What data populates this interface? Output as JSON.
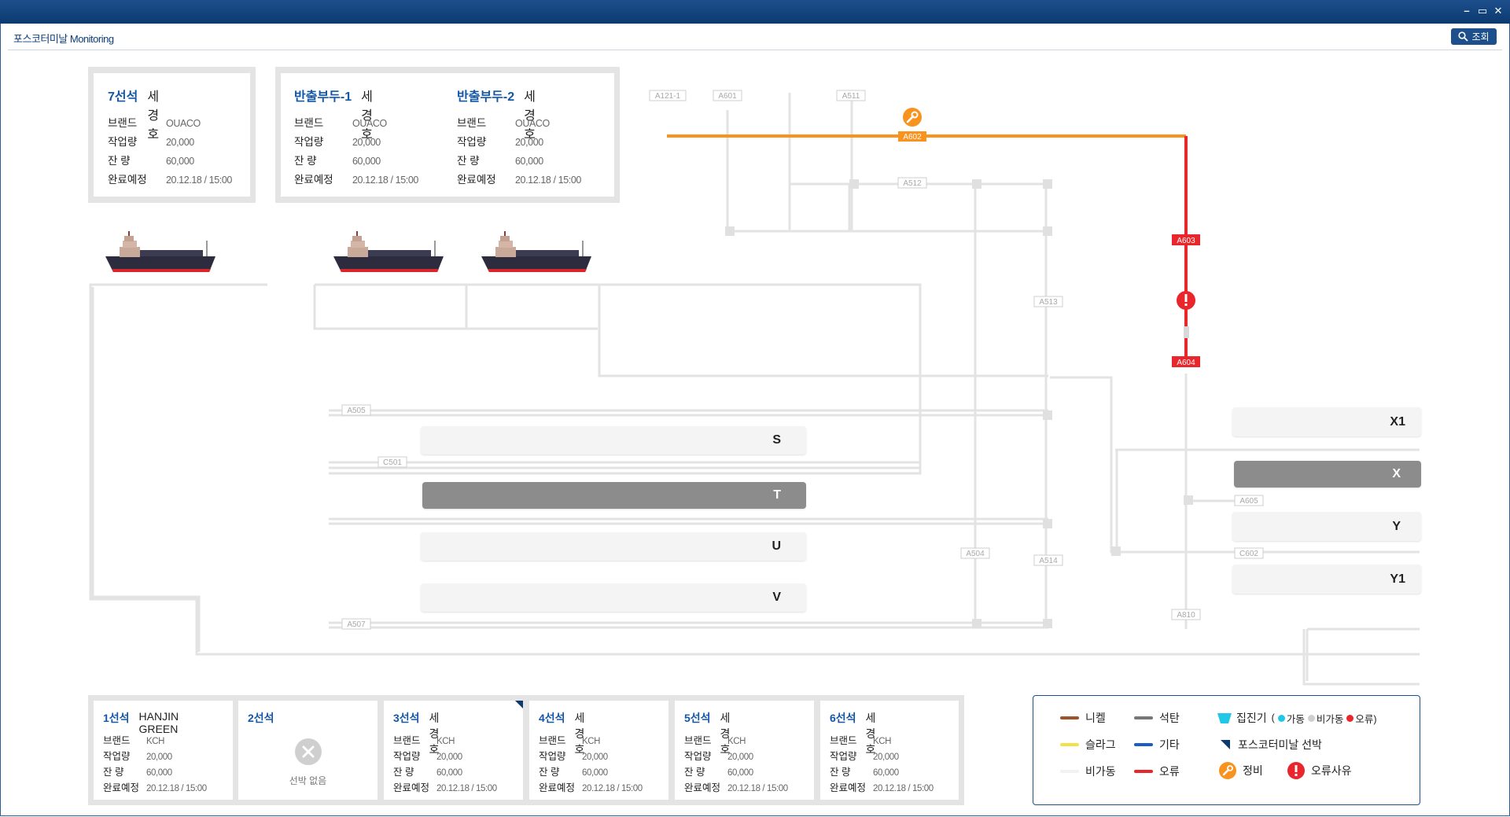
{
  "window": {
    "app_title": "포스코터미날 Monitoring",
    "search_label": "조회",
    "controls": [
      "–",
      "▭",
      "✕"
    ]
  },
  "top_cards": [
    {
      "berth": "7선석",
      "ship": "세경호",
      "brand_label": "브랜드",
      "brand": "OUACO",
      "work_label": "작업량",
      "work": "20,000",
      "remain_label": "잔  량",
      "remain": "60,000",
      "eta_label": "완료예정",
      "eta": "20.12.18 / 15:00"
    },
    {
      "berth": "반출부두-1",
      "ship": "세경호",
      "brand_label": "브랜드",
      "brand": "OUACO",
      "work_label": "작업량",
      "work": "20,000",
      "remain_label": "잔  량",
      "remain": "60,000",
      "eta_label": "완료예정",
      "eta": "20.12.18 / 15:00"
    },
    {
      "berth": "반출부두-2",
      "ship": "세경호",
      "brand_label": "브랜드",
      "brand": "OUACO",
      "work_label": "작업량",
      "work": "20,000",
      "remain_label": "잔  량",
      "remain": "60,000",
      "eta_label": "완료예정",
      "eta": "20.12.18 / 15:00"
    }
  ],
  "bottom_cards": [
    {
      "berth": "1선석",
      "ship": "HANJIN GREEN",
      "brand_label": "브랜드",
      "brand": "KCH",
      "work_label": "작업량",
      "work": "20,000",
      "remain_label": "잔  량",
      "remain": "60,000",
      "eta_label": "완료예정",
      "eta": "20.12.18 / 15:00"
    },
    {
      "berth": "2선석",
      "empty": true,
      "empty_label": "선박 없음"
    },
    {
      "berth": "3선석",
      "ship": "세경호",
      "brand_label": "브랜드",
      "brand": "KCH",
      "work_label": "작업량",
      "work": "20,000",
      "remain_label": "잔  량",
      "remain": "60,000",
      "eta_label": "완료예정",
      "eta": "20.12.18 / 15:00",
      "posco_ship": true
    },
    {
      "berth": "4선석",
      "ship": "세경호",
      "brand_label": "브랜드",
      "brand": "KCH",
      "work_label": "작업량",
      "work": "20,000",
      "remain_label": "잔  량",
      "remain": "60,000",
      "eta_label": "완료예정",
      "eta": "20.12.18 / 15:00"
    },
    {
      "berth": "5선석",
      "ship": "세경호",
      "brand_label": "브랜드",
      "brand": "KCH",
      "work_label": "작업량",
      "work": "20,000",
      "remain_label": "잔  량",
      "remain": "60,000",
      "eta_label": "완료예정",
      "eta": "20.12.18 / 15:00"
    },
    {
      "berth": "6선석",
      "ship": "세경호",
      "brand_label": "브랜드",
      "brand": "KCH",
      "work_label": "작업량",
      "work": "20,000",
      "remain_label": "잔  량",
      "remain": "60,000",
      "eta_label": "완료예정",
      "eta": "20.12.18 / 15:00"
    }
  ],
  "yards": {
    "S": {
      "label": "S",
      "state": "idle"
    },
    "T": {
      "label": "T",
      "state": "active"
    },
    "U": {
      "label": "U",
      "state": "idle"
    },
    "V": {
      "label": "V",
      "state": "idle"
    },
    "X1": {
      "label": "X1",
      "state": "idle"
    },
    "X": {
      "label": "X",
      "state": "active"
    },
    "Y": {
      "label": "Y",
      "state": "idle"
    },
    "Y1": {
      "label": "Y1",
      "state": "idle"
    }
  },
  "conveyors": {
    "A121-1": "A121-1",
    "A601": "A601",
    "A511": "A511",
    "A602": "A602",
    "A512": "A512",
    "A603": "A603",
    "A513": "A513",
    "A604": "A604",
    "A505": "A505",
    "C501": "C501",
    "A605": "A605",
    "A504": "A504",
    "A514": "A514",
    "C602": "C602",
    "A810": "A810",
    "A507": "A507"
  },
  "status_colors": {
    "maintenance": "#f7931e",
    "error": "#e8262b",
    "idle_line": "#e6e6e6"
  },
  "legend": {
    "nickel": "니켈",
    "slag": "슬라그",
    "inactive": "비가동",
    "coal": "석탄",
    "other": "기타",
    "error": "오류",
    "collector": "집진기",
    "collector_open": "(",
    "op": "가동",
    "nonop": "비가동",
    "err": "오류)",
    "posco_ship": "포스코터미날 선박",
    "maintenance": "정비",
    "error_reason": "오류사유",
    "colors": {
      "nickel": "#a0522d",
      "slag": "#f5e04a",
      "inactive": "#f2f2f2",
      "coal": "#777777",
      "other": "#1f5bc4",
      "error": "#e8262b",
      "collector": "#1ec8e6"
    }
  }
}
